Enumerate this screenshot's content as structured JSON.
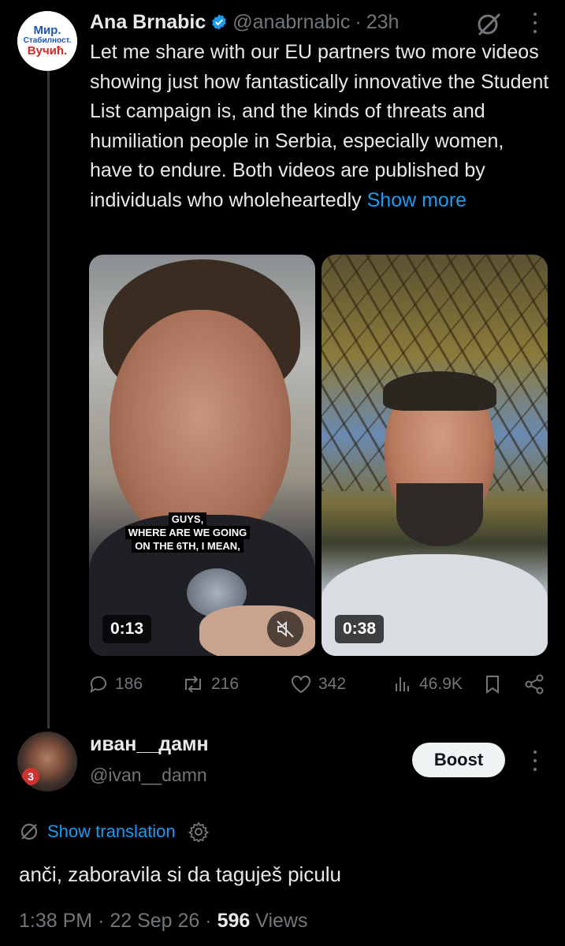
{
  "tweet": {
    "avatar_lines": [
      "Мир.",
      "Стабилност.",
      "Вучић."
    ],
    "author_name": "Ana Brnabic",
    "handle": "@anabrnabic",
    "separator": "·",
    "time_ago": "23h",
    "text": "Let me share with our EU partners two more videos showing just how fantastically innovative the Student List campaign is, and the kinds of threats and humiliation people in Serbia, especially women, have to endure. Both videos are published by individuals who wholeheartedly",
    "show_more": "Show more",
    "media": [
      {
        "duration": "0:13",
        "caption": [
          "GUYS,",
          "WHERE ARE WE GOING",
          "ON THE 6TH, I MEAN,"
        ]
      },
      {
        "duration": "0:38"
      }
    ],
    "stats": {
      "replies": "186",
      "reposts": "216",
      "likes": "342",
      "views": "46.9K"
    }
  },
  "reply": {
    "avatar_badge": "3",
    "display_name": "иван__дамн",
    "handle": "@ivan__damn",
    "boost_label": "Boost",
    "translate_label": "Show translation",
    "text": "anči, zaboravila si da taguješ piculu",
    "time": "1:38 PM",
    "dot": "·",
    "date": "22 Sep 26",
    "views_count": "596",
    "views_label": "Views"
  },
  "colors": {
    "background": "#000000",
    "text_primary": "#e7e9ea",
    "text_secondary": "#71767b",
    "accent": "#1d9bf0",
    "verified": "#1d9bf0"
  },
  "icons": [
    "verified-badge-icon",
    "grok-icon",
    "more-icon",
    "reply-icon",
    "repost-icon",
    "like-icon",
    "views-icon",
    "bookmark-icon",
    "share-icon",
    "mute-icon",
    "translate-icon",
    "settings-icon"
  ]
}
